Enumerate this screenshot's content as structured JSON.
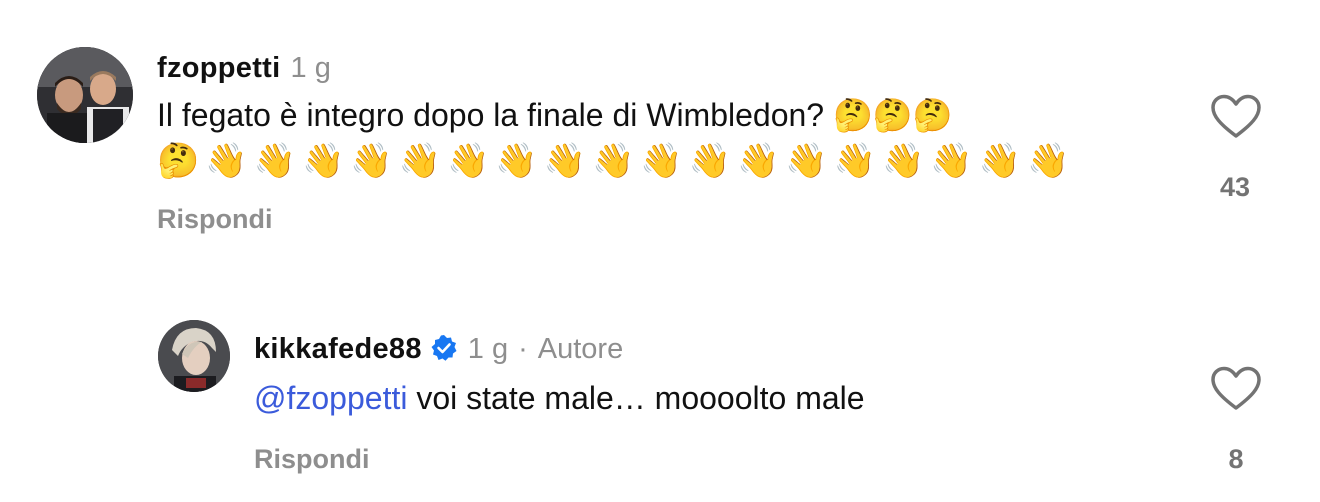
{
  "comments": [
    {
      "username": "fzoppetti",
      "time": "1 g",
      "text": "Il fegato è integro dopo la finale di Wimbledon? 🤔🤔🤔",
      "emoji_line": "🤔👋👋👋👋👋👋👋👋👋👋👋👋👋👋👋👋👋👋",
      "reply_label": "Rispondi",
      "likes": "43"
    },
    {
      "username": "kikkafede88",
      "verified": true,
      "time": "1 g",
      "separator": "·",
      "author_tag": "Autore",
      "mention": "@fzoppetti",
      "text": " voi state male… moooolto male",
      "reply_label": "Rispondi",
      "likes": "8"
    }
  ],
  "colors": {
    "mention": "#3b5bdb",
    "verified": "#1877f2",
    "muted": "#8e8e8e"
  }
}
